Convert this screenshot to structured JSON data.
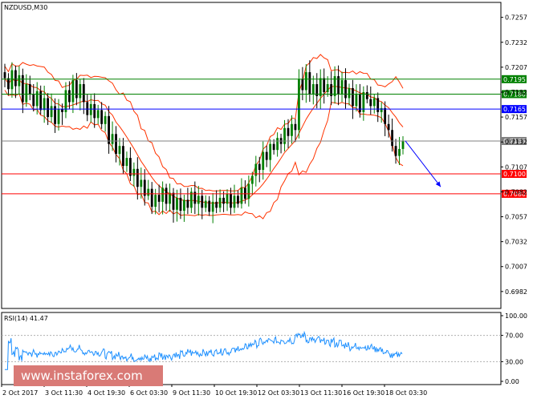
{
  "chart_data": {
    "type": "candlestick",
    "title": "NZDUSD,M30",
    "price_axis": {
      "ylim": [
        0.6965,
        0.7272
      ],
      "ticks": [
        "0.7257",
        "0.7232",
        "0.7207",
        "0.7182",
        "0.7157",
        "0.7132",
        "0.7107",
        "0.7082",
        "0.7057",
        "0.7032",
        "0.7007",
        "0.6982"
      ]
    },
    "x_labels": [
      "2 Oct 2017",
      "3 Oct 11:30",
      "4 Oct 19:30",
      "6 Oct 03:30",
      "9 Oct 11:30",
      "10 Oct 19:30",
      "12 Oct 03:30",
      "13 Oct 11:30",
      "16 Oct 19:30",
      "18 Oct 03:30"
    ],
    "close": [
      0.7196,
      0.7185,
      0.7204,
      0.7188,
      0.7199,
      0.7172,
      0.719,
      0.718,
      0.7168,
      0.7183,
      0.7164,
      0.7176,
      0.7157,
      0.7168,
      0.715,
      0.7165,
      0.7162,
      0.7184,
      0.7172,
      0.7194,
      0.7176,
      0.719,
      0.7172,
      0.7159,
      0.717,
      0.7156,
      0.7164,
      0.715,
      0.7158,
      0.713,
      0.714,
      0.712,
      0.7128,
      0.7108,
      0.7116,
      0.7098,
      0.7105,
      0.7087,
      0.7094,
      0.7078,
      0.7085,
      0.7067,
      0.7079,
      0.7072,
      0.7086,
      0.707,
      0.7081,
      0.7064,
      0.7076,
      0.7063,
      0.7074,
      0.7066,
      0.7082,
      0.707,
      0.7078,
      0.7066,
      0.7073,
      0.7062,
      0.7072,
      0.7066,
      0.7076,
      0.707,
      0.708,
      0.7066,
      0.7078,
      0.707,
      0.7086,
      0.7075,
      0.709,
      0.7098,
      0.711,
      0.7104,
      0.7122,
      0.7114,
      0.713,
      0.7124,
      0.7136,
      0.713,
      0.7146,
      0.7138,
      0.715,
      0.7144,
      0.7195,
      0.7184,
      0.7202,
      0.718,
      0.719,
      0.7178,
      0.7196,
      0.7182,
      0.719,
      0.7178,
      0.7198,
      0.718,
      0.7194,
      0.7176,
      0.7186,
      0.7168,
      0.718,
      0.7162,
      0.7182,
      0.7175,
      0.7168,
      0.7176,
      0.7162,
      0.7166,
      0.715,
      0.7144,
      0.7128,
      0.7118,
      0.7125,
      0.7133
    ],
    "rsi": {
      "label": "RSI(14) 41.47",
      "ylim": [
        0,
        100
      ],
      "ticks": [
        "100.00",
        "70.00",
        "30.00",
        "0.00"
      ]
    },
    "levels": [
      {
        "value": 0.7195,
        "label": "0.7195",
        "color": "#008000"
      },
      {
        "value": 0.718,
        "label": "0.7180",
        "color": "#008000"
      },
      {
        "value": 0.7165,
        "label": "0.7165",
        "color": "#0000ff"
      },
      {
        "value": 0.7133,
        "label": "0.7133",
        "color": "#808080"
      },
      {
        "value": 0.71,
        "label": "0.7100",
        "color": "#ff0000"
      },
      {
        "value": 0.708,
        "label": "0.7080",
        "color": "#ff0000"
      }
    ],
    "forecast_arrow": {
      "from": 0.7133,
      "to": 0.7087,
      "color": "#0000ff"
    },
    "colors": {
      "bull": "#008000",
      "bear": "#000000",
      "bands": "#ff3300",
      "rsi_line": "#1e90ff"
    }
  },
  "watermark": "www.instaforex.com"
}
